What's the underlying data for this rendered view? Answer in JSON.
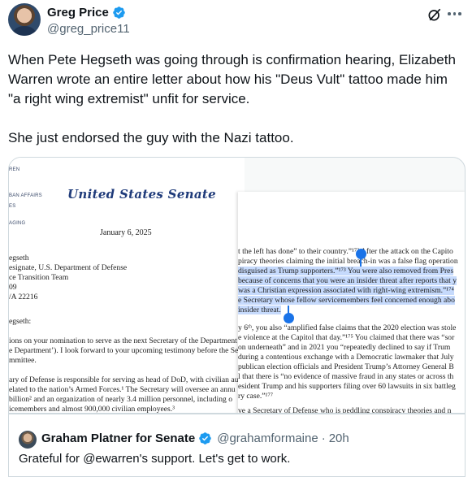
{
  "author": {
    "display_name": "Greg Price",
    "handle": "@greg_price11"
  },
  "tweet": {
    "text_paragraphs": [
      "When Pete Hegseth was going through is confirmation hearing, Elizabeth Warren wrote an entire letter about how his \"Deus Vult\" tattoo made him \"a right wing extremist\" unfit for service.",
      "She just endorsed the guy with the Nazi tattoo."
    ]
  },
  "media": {
    "letterhead_small": [
      "REN",
      "BAN AFFAIRS",
      "ES",
      "AGING"
    ],
    "senate_title": "United States Senate",
    "date": "January 6, 2025",
    "address_lines": [
      "egseth",
      "esignate, U.S. Department of Defense",
      "ce Transition Team",
      "09",
      "/A 22216"
    ],
    "salutation": "egseth:",
    "body_lines": [
      "ions on your nomination to serve as the next Secretary of the Department",
      "e Department’). I look forward to your upcoming testimony before the Se",
      "mmittee.",
      "ary of Defense is responsible for serving as head of DoD, with civilian aut",
      "elated to the nation’s Armed Forces.¹ The Secretary will oversee an annu",
      " billion² and an organization of nearly 3.4 million personnel, including o",
      "icemembers and almost 900,000 civilian employees.³"
    ],
    "right_lines": [
      "t the left has done” to their country.”¹⁷² After the attack on the Capito",
      "piracy theories claiming the initial breach-in was a false flag operation",
      " disguised as Trump supporters.”¹⁷³ You were also removed from Pres",
      "because of concerns that you were an insider threat after reports that y",
      "was a Christian expression associated with right-wing extremism.”¹⁷⁴",
      "e Secretary whose fellow servicemembers feel concerned enough abo",
      " insider threat.",
      "y 6ᵗʰ, you also “amplified false claims that the 2020 election was stole",
      "e violence at the Capitol that day.”¹⁷⁵ You claimed that there was “sor",
      " on underneath” and in 2021 you “repeatedly declined to say if Trum",
      " during a contentious exchange with a Democratic lawmaker that July",
      "publican election officials and President Trump’s Attorney General B",
      "l that there is “no evidence of massive fraud in any states or across th",
      "esident Trump and his supporters filing over 60 lawsuits in six battleg",
      "ry case.”¹⁷⁷",
      "ve a Secretary of Defense who is peddling conspiracy theories and n"
    ]
  },
  "quote": {
    "display_name": "Graham Platner for Senate",
    "handle": "@grahamformaine",
    "separator": "·",
    "time": "20h",
    "text": "Grateful for @ewarren's support. Let's get to work."
  },
  "icons": {
    "verified": "verified-badge-icon",
    "grok": "grok-icon",
    "more": "more-options-icon"
  },
  "colors": {
    "verified_blue": "#1d9bf0",
    "selection_blue": "#1a73e8",
    "text_primary": "#0f1419",
    "text_secondary": "#536471"
  }
}
